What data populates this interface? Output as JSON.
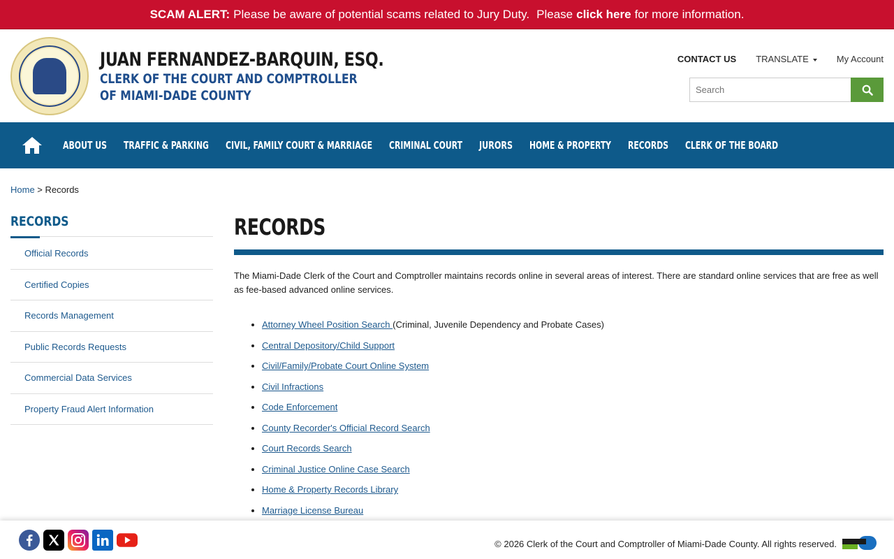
{
  "alert": {
    "label": "SCAM ALERT:",
    "text1": "Please be aware of potential scams related to Jury Duty.",
    "text2": "Please",
    "link": "click here",
    "text3": "for more information."
  },
  "brand": {
    "name": "JUAN FERNANDEZ-BARQUIN, ESQ.",
    "line1": "CLERK OF THE COURT AND COMPTROLLER",
    "line2": "OF MIAMI-DADE COUNTY"
  },
  "utils": {
    "contact": "CONTACT US",
    "translate": "TRANSLATE",
    "account": "My Account"
  },
  "search": {
    "placeholder": "Search"
  },
  "nav": {
    "items": [
      "ABOUT US",
      "TRAFFIC & PARKING",
      "CIVIL, FAMILY COURT & MARRIAGE",
      "CRIMINAL COURT",
      "JURORS",
      "HOME & PROPERTY",
      "RECORDS",
      "CLERK OF THE BOARD"
    ]
  },
  "breadcrumb": {
    "home": "Home",
    "sep": " > ",
    "current": "Records"
  },
  "sidebar": {
    "title": "RECORDS",
    "items": [
      "Official Records",
      "Certified Copies",
      "Records Management",
      "Public Records Requests",
      "Commercial Data Services",
      "Property Fraud Alert Information"
    ]
  },
  "main": {
    "title": "RECORDS",
    "intro": "The Miami-Dade Clerk of the Court and Comptroller maintains records online in several areas of interest. There are standard online services that are free as well as fee-based advanced online services.",
    "links": [
      {
        "label": "Attorney Wheel Position Search ",
        "note": "(Criminal, Juvenile Dependency and Probate Cases)"
      },
      {
        "label": "Central Depository/Child Support",
        "note": ""
      },
      {
        "label": "Civil/Family/Probate Court Online System",
        "note": ""
      },
      {
        "label": "Civil Infractions",
        "note": ""
      },
      {
        "label": "Code Enforcement",
        "note": ""
      },
      {
        "label": "County Recorder's Official Record Search",
        "note": ""
      },
      {
        "label": "Court Records Search",
        "note": ""
      },
      {
        "label": "Criminal Justice Online Case Search",
        "note": ""
      },
      {
        "label": "Home & Property Records Library",
        "note": ""
      },
      {
        "label": "Marriage License Bureau",
        "note": ""
      }
    ]
  },
  "footer": {
    "copyright": "© 2026 Clerk of the Court and Comptroller of Miami-Dade County. All rights reserved."
  },
  "colors": {
    "alert": "#c8102e",
    "nav": "#0e5a8a",
    "link": "#1e5a8e",
    "search_button": "#5a9a3a"
  }
}
